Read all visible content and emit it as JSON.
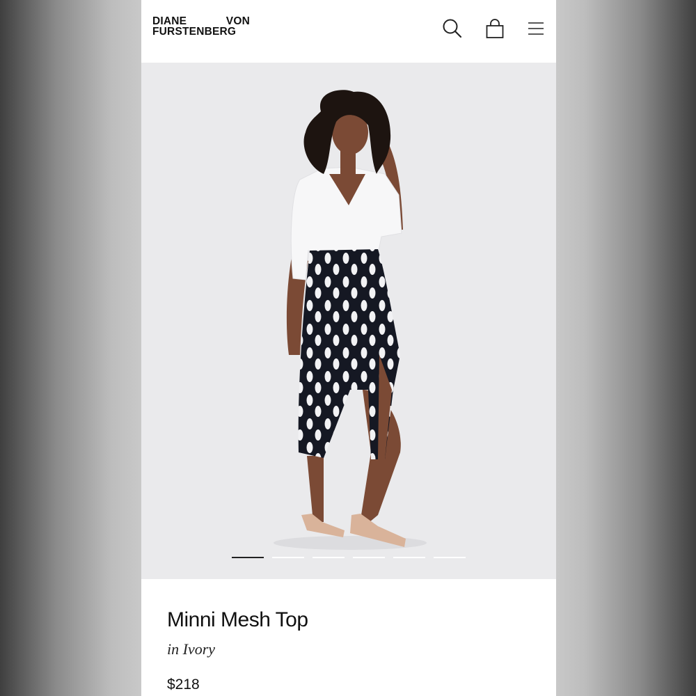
{
  "brand": {
    "logo_line1_left": "DIANE",
    "logo_line1_right": "VON",
    "logo_line2": "FURSTENBERG"
  },
  "header": {
    "icons": [
      "search-icon",
      "shopping-bag-icon",
      "hamburger-menu-icon"
    ]
  },
  "gallery": {
    "image_count": 6,
    "active_index": 0
  },
  "product": {
    "name": "Minni Mesh Top",
    "color": "in Ivory",
    "price": "$218"
  },
  "colors": {
    "background": "#ffffff",
    "hero_bg": "#eaeaec",
    "text": "#111111",
    "indicator_active": "#222222",
    "indicator_inactive": "#ffffff"
  }
}
